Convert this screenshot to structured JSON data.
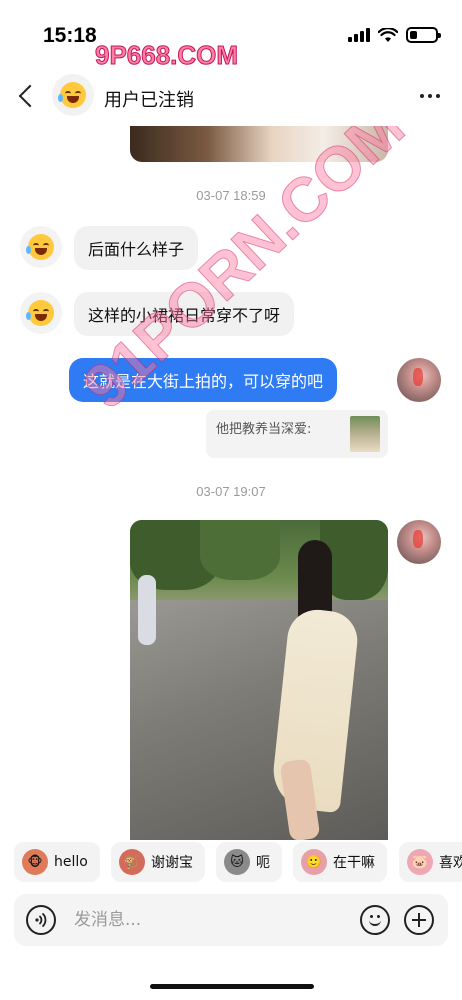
{
  "status_bar": {
    "time": "15:18",
    "battery_level": 0.3
  },
  "watermarks": {
    "top": "9P668.COM",
    "diagonal": "91PORN.COM"
  },
  "header": {
    "title": "用户已注销"
  },
  "messages": {
    "timestamp_1": "03-07 18:59",
    "incoming_1": "后面什么样子",
    "incoming_2": "这样的小裙裙日常穿不了呀",
    "outgoing_1": "这就是在大街上拍的，可以穿的吧",
    "quote_text": "他把教养当深爱:",
    "timestamp_2": "03-07 19:07"
  },
  "quick_replies": [
    {
      "label": "hello",
      "icon": "monkey-icon",
      "color": "#e07b5a"
    },
    {
      "label": "谢谢宝",
      "icon": "monkey-thanks-icon",
      "color": "#d66a5a"
    },
    {
      "label": "呃",
      "icon": "cat-icon",
      "color": "#6b6b6b"
    },
    {
      "label": "在干嘛",
      "icon": "girl-icon",
      "color": "#e7a0a8"
    },
    {
      "label": "喜欢",
      "icon": "pig-icon",
      "color": "#f0a7b4"
    }
  ],
  "input": {
    "placeholder": "发消息..."
  },
  "colors": {
    "outgoing_bubble": "#2f7bf4",
    "incoming_bubble": "#f1f1f1"
  }
}
